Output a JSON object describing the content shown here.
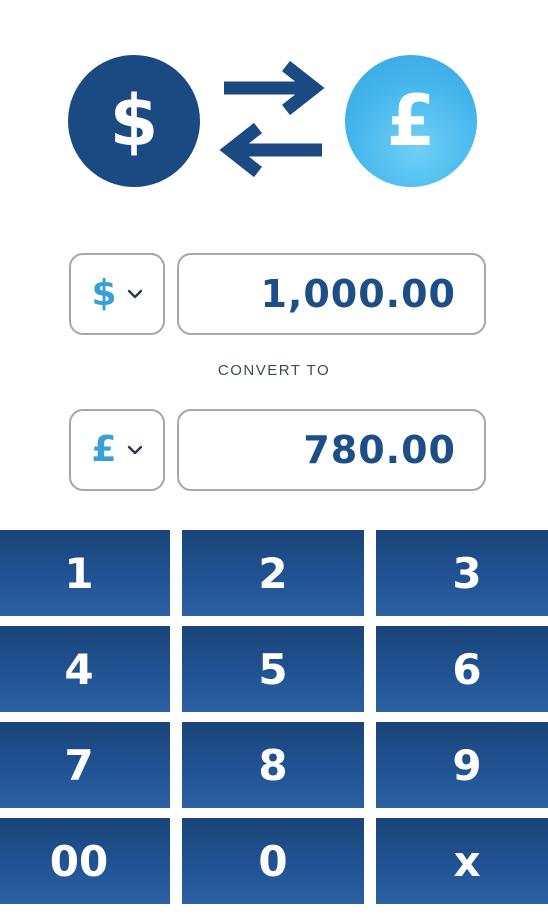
{
  "header": {
    "from_symbol": "$",
    "to_symbol": "£",
    "swap_icon": "swap-arrows-icon",
    "colors": {
      "from_circle": "#1b4a83",
      "to_circle": "#45b6ec",
      "arrows": "#1b4a83"
    }
  },
  "converter": {
    "from": {
      "currency_symbol": "$",
      "amount": "1,000.00"
    },
    "convert_label": "CONVERT TO",
    "to": {
      "currency_symbol": "£",
      "amount": "780.00"
    },
    "dropdown_icon": "chevron-down-icon",
    "accent_color": "#3a9fd8",
    "amount_color": "#1d4f86"
  },
  "keypad": {
    "keys": [
      "1",
      "2",
      "3",
      "4",
      "5",
      "6",
      "7",
      "8",
      "9",
      "00",
      "0",
      "x"
    ],
    "key_color": "#205393"
  }
}
